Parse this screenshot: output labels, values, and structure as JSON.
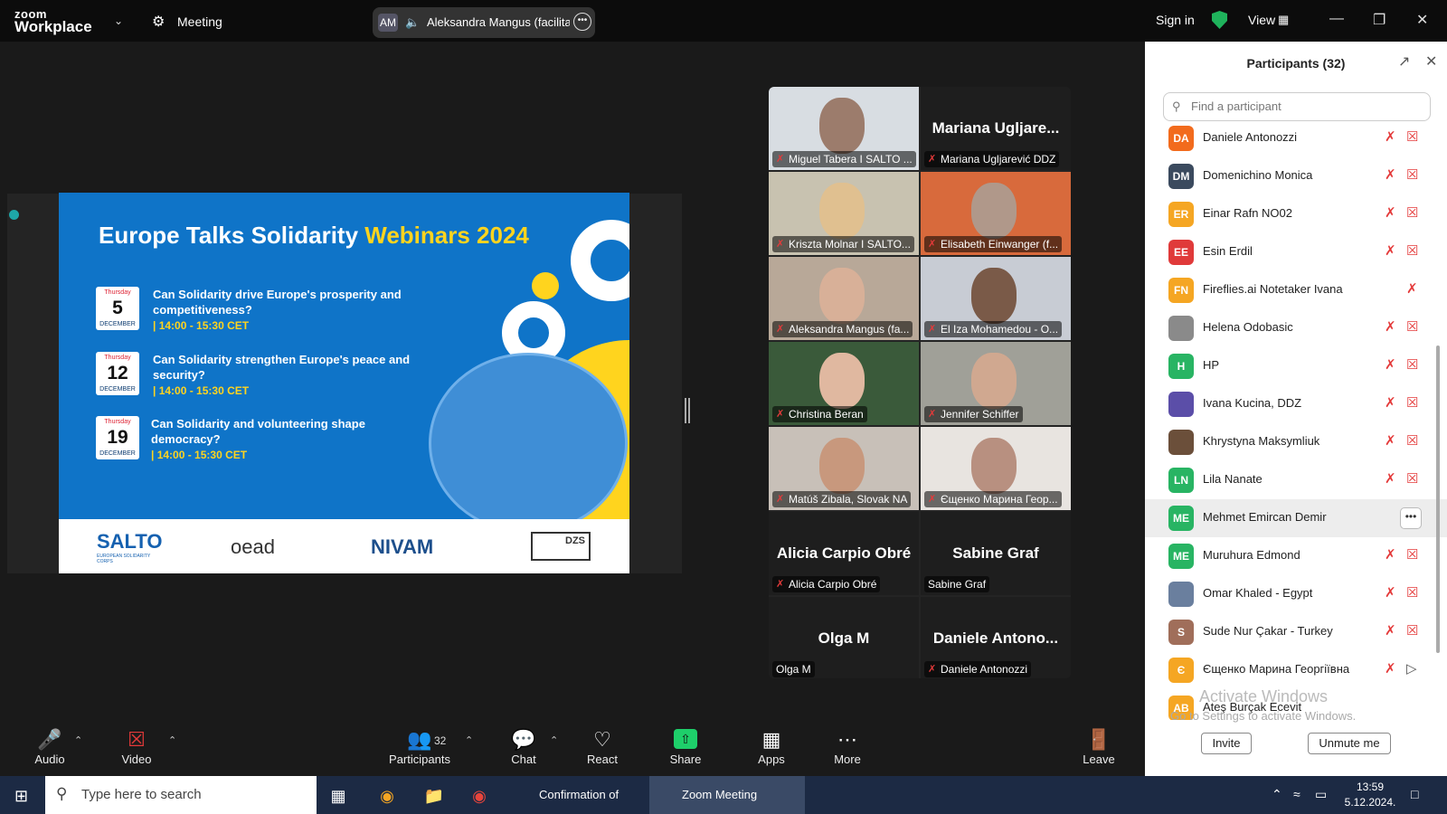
{
  "titlebar": {
    "logo_top": "zoom",
    "logo_bottom": "Workplace",
    "meeting_label": "Meeting",
    "speaker_initials": "AM",
    "speaker_name": "Aleksandra Mangus (facilitator)",
    "sign_in": "Sign in",
    "view": "View"
  },
  "slide": {
    "title_main": "Europe Talks Solidarity ",
    "title_highlight": "Webinars 2024",
    "events": [
      {
        "weekday": "Thursday",
        "day": "5",
        "month": "DECEMBER",
        "question": "Can Solidarity drive Europe's prosperity and competitiveness?",
        "time": "| 14:00 - 15:30 CET"
      },
      {
        "weekday": "Thursday",
        "day": "12",
        "month": "DECEMBER",
        "question": "Can Solidarity strengthen Europe's peace and security?",
        "time": "| 14:00 - 15:30 CET"
      },
      {
        "weekday": "Thursday",
        "day": "19",
        "month": "DECEMBER",
        "question": "Can Solidarity and volunteering shape democracy?",
        "time": "| 14:00 - 15:30 CET"
      }
    ],
    "logos": [
      "SALTO",
      "EUROPEAN SOLIDARITY CORPS",
      "oead",
      "NIVAM",
      "DZS"
    ]
  },
  "gallery": {
    "tiles": [
      {
        "name": "Miguel Tabera I SALTO ...",
        "big": "",
        "muted": true,
        "video": true
      },
      {
        "name": "Mariana Ugljarević DDZ",
        "big": "Mariana Ugljare...",
        "muted": true,
        "video": false
      },
      {
        "name": "Kriszta Molnar I SALTO...",
        "big": "",
        "muted": true,
        "video": true
      },
      {
        "name": "Elisabeth Einwanger (f...",
        "big": "",
        "muted": true,
        "video": true
      },
      {
        "name": "Aleksandra Mangus (fa...",
        "big": "",
        "muted": true,
        "video": true
      },
      {
        "name": "El Iza Mohamedou - O...",
        "big": "",
        "muted": true,
        "video": true
      },
      {
        "name": "Christina Beran",
        "big": "",
        "muted": true,
        "video": true
      },
      {
        "name": "Jennifer Schiffer",
        "big": "",
        "muted": true,
        "video": true
      },
      {
        "name": "Matúš Zibala, Slovak NA",
        "big": "",
        "muted": true,
        "video": true
      },
      {
        "name": "Єщенко Марина Геор...",
        "big": "",
        "muted": true,
        "video": true
      },
      {
        "name": "Alicia Carpio Obré",
        "big": "Alicia Carpio Obré",
        "muted": true,
        "video": false
      },
      {
        "name": "Sabine Graf",
        "big": "Sabine Graf",
        "muted": false,
        "video": false
      },
      {
        "name": "Olga M",
        "big": "Olga M",
        "muted": false,
        "video": false
      },
      {
        "name": "Daniele Antonozzi",
        "big": "Daniele Antono...",
        "muted": true,
        "video": false
      }
    ]
  },
  "toolbar": {
    "audio": "Audio",
    "video": "Video",
    "participants": "Participants",
    "participants_count": "32",
    "chat": "Chat",
    "react": "React",
    "share": "Share",
    "apps": "Apps",
    "more": "More",
    "leave": "Leave"
  },
  "panel": {
    "title": "Participants (32)",
    "search_placeholder": "Find a participant",
    "participants": [
      {
        "initials": "DA",
        "name": "Daniele Antonozzi",
        "color": "#f26b1d"
      },
      {
        "initials": "DM",
        "name": "Domenichino Monica",
        "color": "#3b4a5e"
      },
      {
        "initials": "ER",
        "name": "Einar Rafn NO02",
        "color": "#f5a623"
      },
      {
        "initials": "EE",
        "name": "Esin Erdil",
        "color": "#e03a3a"
      },
      {
        "initials": "FN",
        "name": "Fireflies.ai Notetaker Ivana",
        "color": "#f5a623"
      },
      {
        "initials": "",
        "name": "Helena Odobasic",
        "color": "#8a8a8a"
      },
      {
        "initials": "H",
        "name": "HP",
        "color": "#28b463"
      },
      {
        "initials": "",
        "name": "Ivana Kucina, DDZ",
        "color": "#5b4ea8"
      },
      {
        "initials": "",
        "name": "Khrystyna Maksymliuk",
        "color": "#6b4f3a"
      },
      {
        "initials": "LN",
        "name": "Lila Nanate",
        "color": "#28b463"
      },
      {
        "initials": "ME",
        "name": "Mehmet Emircan Demir",
        "color": "#28b463"
      },
      {
        "initials": "ME",
        "name": "Muruhura Edmond",
        "color": "#28b463"
      },
      {
        "initials": "",
        "name": "Omar Khaled - Egypt",
        "color": "#6a7f9e"
      },
      {
        "initials": "S",
        "name": "Sude Nur Çakar - Turkey",
        "color": "#a06e5a"
      },
      {
        "initials": "Є",
        "name": "Єщенко Марина Георгіївна",
        "color": "#f5a623"
      },
      {
        "initials": "AB",
        "name": "Ateş Burçak Ecevit",
        "color": "#f5a623"
      }
    ],
    "watermark_title": "Activate Windows",
    "watermark_sub": "Go to Settings to activate Windows.",
    "invite": "Invite",
    "unmute_me": "Unmute me"
  },
  "taskbar": {
    "search_placeholder": "Type here to search",
    "item_chrome": "Confirmation of yo...",
    "item_zoom": "Zoom Meeting",
    "time": "13:59",
    "date": "5.12.2024."
  }
}
